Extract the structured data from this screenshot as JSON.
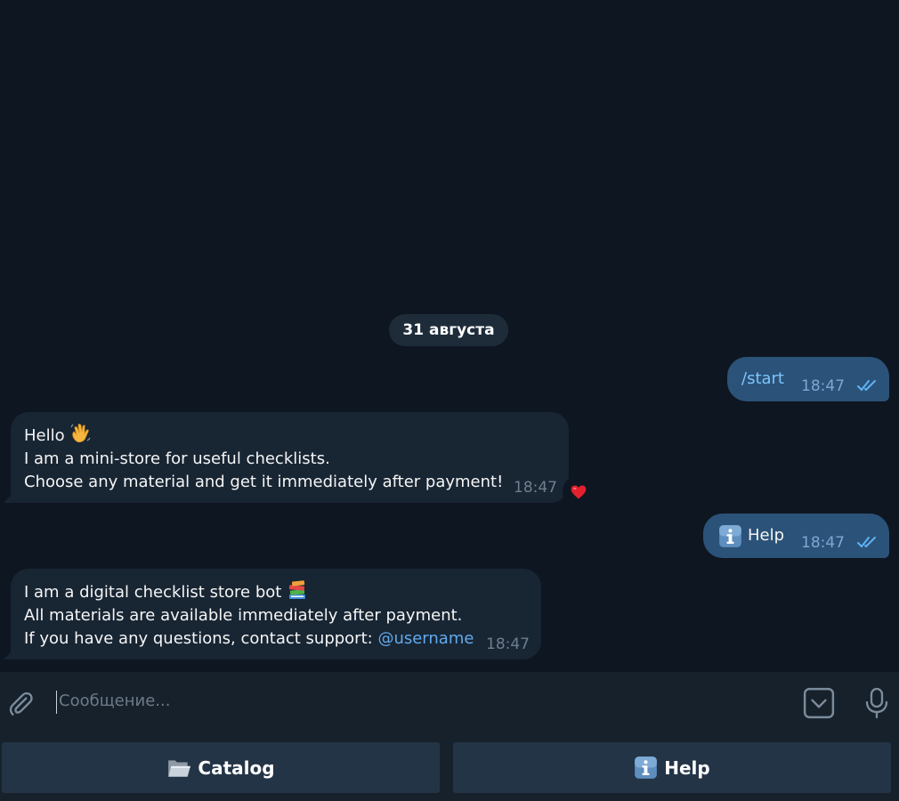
{
  "chat": {
    "date_separator": "31 августа",
    "messages": [
      {
        "direction": "outgoing",
        "text": "/start",
        "time": "18:47",
        "status": "read"
      },
      {
        "direction": "incoming",
        "lines": [
          "Hello",
          "I am a mini-store for useful checklists.",
          "Choose any material and get it immediately after payment!"
        ],
        "emoji": "waving-hand-emoji",
        "time": "18:47",
        "reaction": "red-heart-emoji"
      },
      {
        "direction": "outgoing",
        "icon": "info-emoji",
        "text": "Help",
        "time": "18:47",
        "status": "read"
      },
      {
        "direction": "incoming",
        "lines": [
          "I am a digital checklist store bot",
          "All materials are available immediately after payment.",
          "If you have any questions, contact support: "
        ],
        "emoji": "books-emoji",
        "link": "@username",
        "time": "18:47"
      }
    ]
  },
  "composer": {
    "placeholder": "Сообщение...",
    "attach_icon": "paperclip-icon",
    "keyboard_toggle_icon": "keyboard-toggle-icon",
    "voice_icon": "microphone-icon"
  },
  "keyboard": {
    "buttons": [
      {
        "icon": "open-folder-emoji",
        "label": "Catalog"
      },
      {
        "icon": "info-emoji",
        "label": "Help"
      }
    ]
  },
  "colors": {
    "background": "#0e1621",
    "incoming_bubble": "#182533",
    "outgoing_bubble": "#2b5278",
    "link": "#62aaec",
    "read_ticks": "#5fb4f5",
    "panel": "#17212b",
    "keyboard_button": "#243447"
  }
}
